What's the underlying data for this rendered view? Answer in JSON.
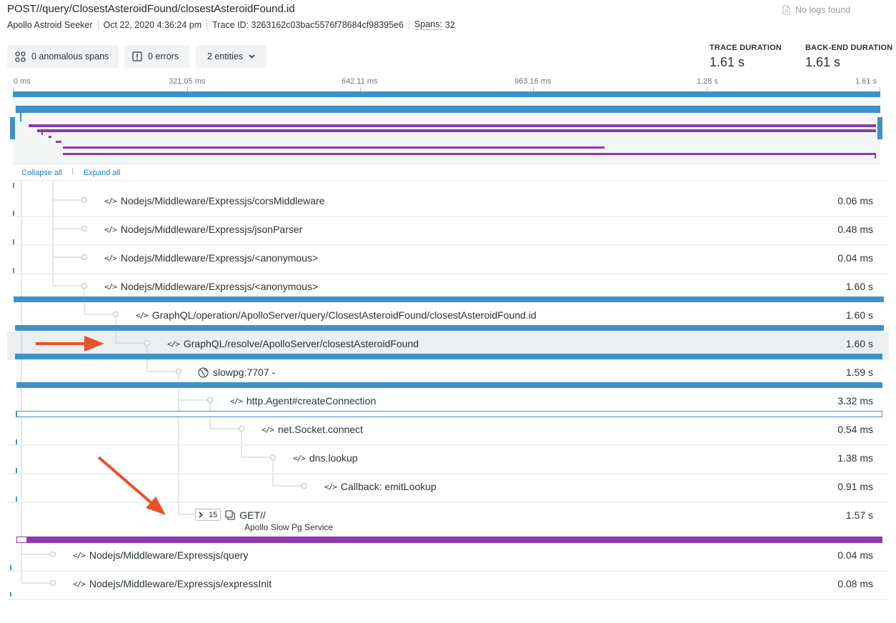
{
  "header": {
    "title": "POST//query/ClosestAsteroidFound/closestAsteroidFound.id",
    "app_name": "Apollo Astroid Seeker",
    "timestamp": "Oct 22, 2020 4:36:24 pm",
    "trace_id": "Trace ID: 3263162c03bac5576f78684cf98395e6",
    "spans_label": "Spans:",
    "spans_count": "32",
    "no_logs": "No logs found"
  },
  "toolbar": {
    "anomalous": "0 anomalous spans",
    "errors": "0 errors",
    "entities": "2 entities"
  },
  "stats": {
    "trace_duration_label": "TRACE DURATION",
    "trace_duration_value": "1.61 s",
    "backend_duration_label": "BACK-END DURATION",
    "backend_duration_value": "1.61 s"
  },
  "timeline": {
    "ticks": [
      "0 ms",
      "321.05 ms",
      "642.11 ms",
      "963.16 ms",
      "1.28 s",
      "1.61 s"
    ]
  },
  "controls": {
    "collapse_all": "Collapse all",
    "expand_all": "Expand all"
  },
  "spans": [
    {
      "name": "Nodejs/Middleware/Expressjs/corsMiddleware",
      "duration": "0.06 ms",
      "icon": "code-icon"
    },
    {
      "name": "Nodejs/Middleware/Expressjs/jsonParser",
      "duration": "0.48 ms",
      "icon": "code-icon"
    },
    {
      "name": "Nodejs/Middleware/Expressjs/<anonymous>",
      "duration": "0.04 ms",
      "icon": "code-icon"
    },
    {
      "name": "Nodejs/Middleware/Expressjs/<anonymous>",
      "duration": "1.60 s",
      "icon": "code-icon"
    },
    {
      "name": "GraphQL/operation/ApolloServer/query/ClosestAsteroidFound/closestAsteroidFound.id",
      "duration": "1.60 s",
      "icon": "code-icon"
    },
    {
      "name": "GraphQL/resolve/ApolloServer/closestAsteroidFound",
      "duration": "1.60 s",
      "icon": "code-icon"
    },
    {
      "name": "slowpg:7707 -",
      "duration": "1.59 s",
      "icon": "globe-icon"
    },
    {
      "name": "http.Agent#createConnection",
      "duration": "3.32 ms",
      "icon": "code-icon"
    },
    {
      "name": "net.Socket.connect",
      "duration": "0.54 ms",
      "icon": "code-icon"
    },
    {
      "name": "dns.lookup",
      "duration": "1.38 ms",
      "icon": "code-icon"
    },
    {
      "name": "Callback: emitLookup",
      "duration": "0.91 ms",
      "icon": "code-icon"
    },
    {
      "name": "GET//",
      "service": "Apollo Slow Pg Service",
      "child_count": "15",
      "duration": "1.57 s",
      "icon": "external-service-icon"
    },
    {
      "name": "Nodejs/Middleware/Expressjs/query",
      "duration": "0.04 ms",
      "icon": "code-icon"
    },
    {
      "name": "Nodejs/Middleware/Expressjs/expressInit",
      "duration": "0.08 ms",
      "icon": "code-icon"
    }
  ],
  "colors": {
    "backend_span": "#3f91c8",
    "external_span": "#8c3aac",
    "annotation_arrow": "#e8512a",
    "link": "#1d7fc2"
  }
}
